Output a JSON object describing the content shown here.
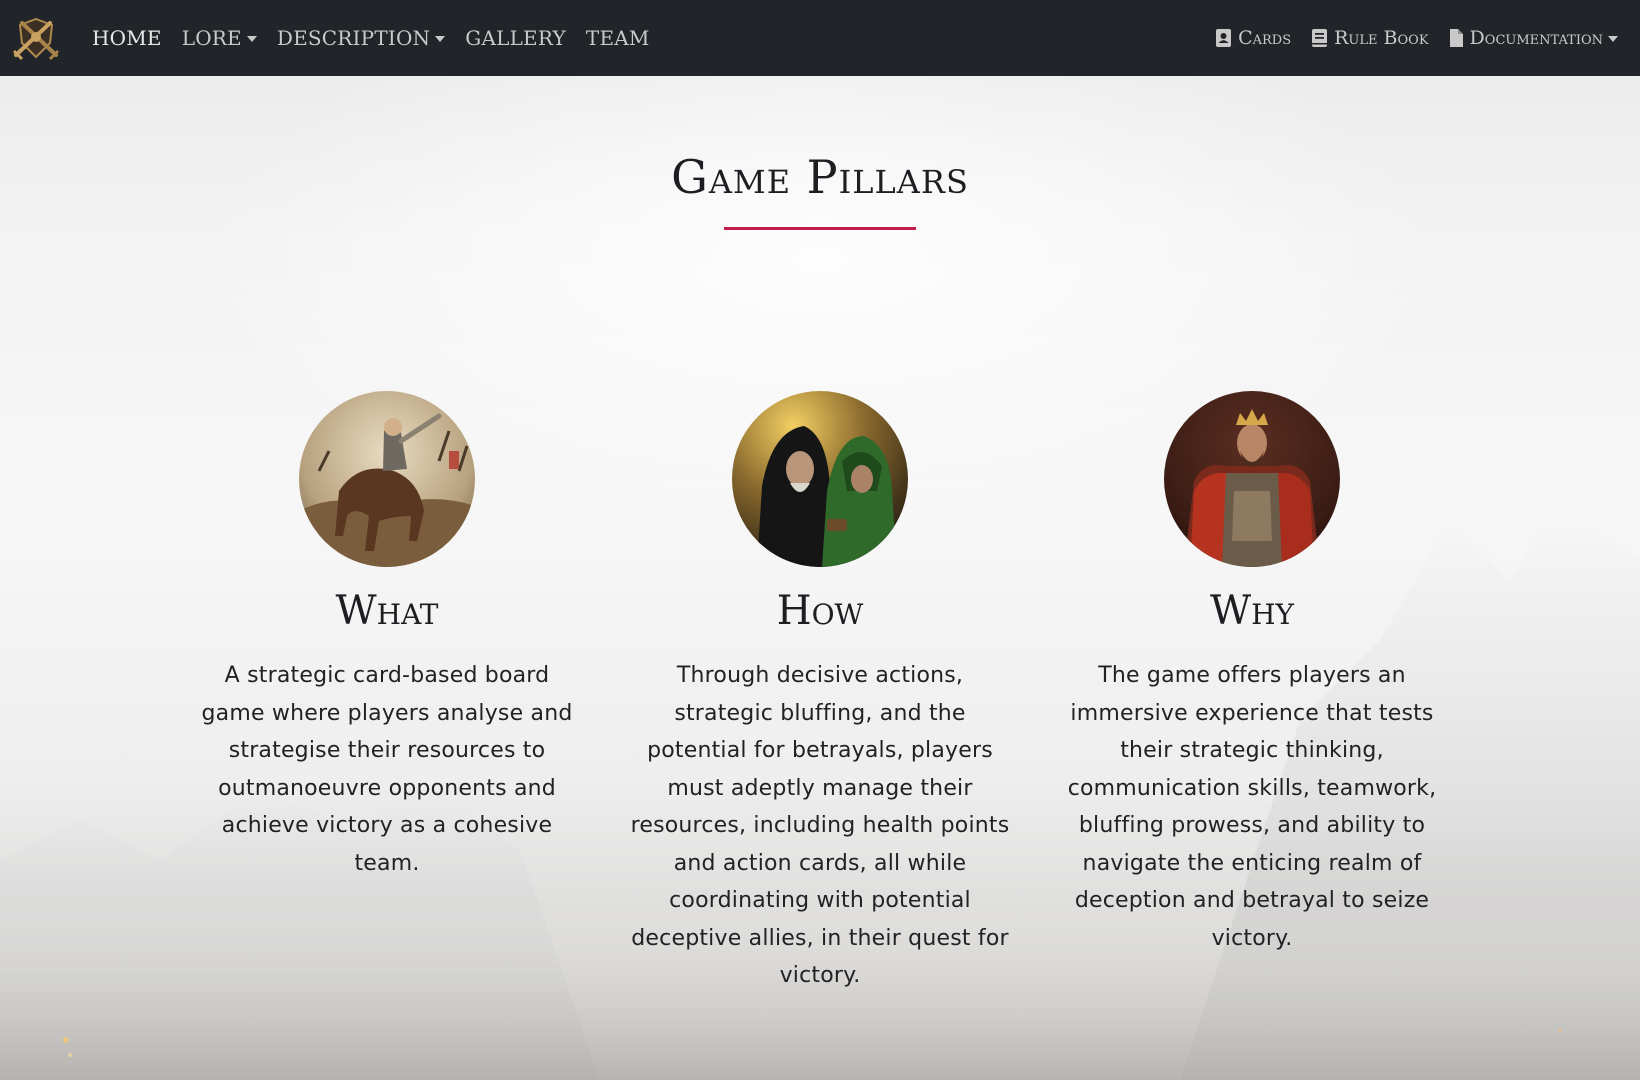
{
  "nav": {
    "logo_icon": "crossed-swords-shield-logo",
    "left_items": [
      {
        "label": "HOME",
        "dropdown": false
      },
      {
        "label": "LORE",
        "dropdown": true
      },
      {
        "label": "DESCRIPTION",
        "dropdown": true
      },
      {
        "label": "GALLERY",
        "dropdown": false
      },
      {
        "label": "TEAM",
        "dropdown": false
      }
    ],
    "right_items": [
      {
        "label": "Cards",
        "icon": "contact-card-icon",
        "dropdown": false
      },
      {
        "label": "Rule Book",
        "icon": "book-icon",
        "dropdown": false
      },
      {
        "label": "Documentation",
        "icon": "file-icon",
        "dropdown": true
      }
    ]
  },
  "section": {
    "title": "Game Pillars",
    "accent_color": "#c21e4b"
  },
  "pillars": [
    {
      "title": "What",
      "image": "knight-on-horseback-portrait",
      "text": "A strategic card-based board game where players analyse and strategise their resources to outmanoeuvre opponents and achieve victory as a cohesive team."
    },
    {
      "title": "How",
      "image": "hooded-conspirators-portrait",
      "text": "Through decisive actions, strategic bluffing, and the potential for betrayals, players must adeptly manage their resources, including health points and action cards, all while coordinating with potential deceptive allies, in their quest for victory."
    },
    {
      "title": "Why",
      "image": "king-on-throne-portrait",
      "text": "The game offers players an immersive experience that tests their strategic thinking, communication skills, teamwork, bluffing prowess, and ability to navigate the enticing realm of deception and betrayal to seize victory."
    }
  ]
}
